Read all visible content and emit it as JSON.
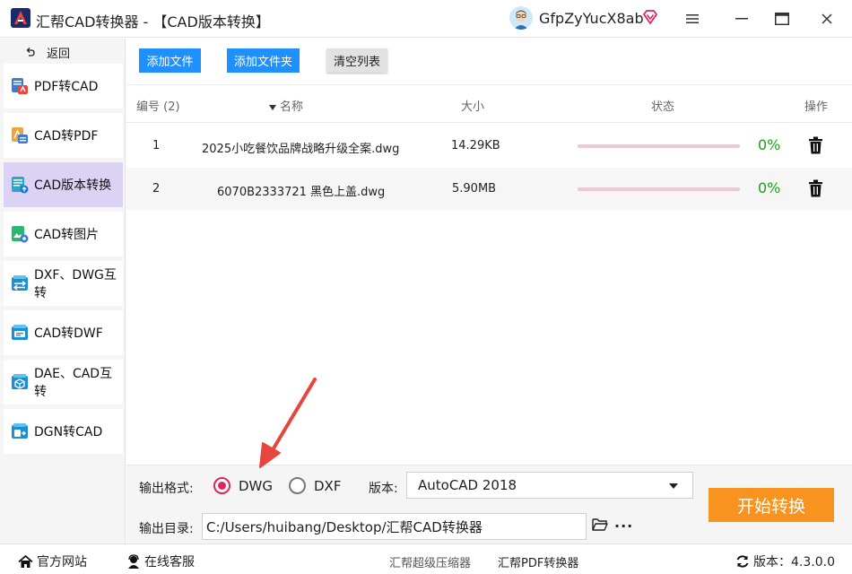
{
  "app": {
    "title": "汇帮CAD转换器 - 【CAD版本转换】",
    "username": "GfpZyYucX8ab"
  },
  "sidebar": {
    "back_label": "返回",
    "items": [
      {
        "label": "PDF转CAD",
        "icon": "pdf-to-cad-icon"
      },
      {
        "label": "CAD转PDF",
        "icon": "cad-to-pdf-icon"
      },
      {
        "label": "CAD版本转换",
        "icon": "cad-version-icon",
        "active": true
      },
      {
        "label": "CAD转图片",
        "icon": "cad-to-image-icon"
      },
      {
        "label": "DXF、DWG互转",
        "icon": "dxf-dwg-icon"
      },
      {
        "label": "CAD转DWF",
        "icon": "cad-to-dwf-icon"
      },
      {
        "label": "DAE、CAD互转",
        "icon": "dae-cad-icon"
      },
      {
        "label": "DGN转CAD",
        "icon": "dgn-to-cad-icon"
      }
    ]
  },
  "toolbar": {
    "add_file": "添加文件",
    "add_folder": "添加文件夹",
    "clear_list": "清空列表"
  },
  "table": {
    "headers": {
      "index": "编号 (2)",
      "name": "名称",
      "size": "大小",
      "status": "状态",
      "action": "操作"
    },
    "rows": [
      {
        "index": "1",
        "name": "2025小吃餐饮品牌战略升级全案.dwg",
        "size": "14.29KB",
        "progress": 0,
        "percent": "0%"
      },
      {
        "index": "2",
        "name": "6070B2333721 黑色上盖.dwg",
        "size": "5.90MB",
        "progress": 0,
        "percent": "0%"
      }
    ]
  },
  "options": {
    "format_label": "输出格式:",
    "format_dwg": "DWG",
    "format_dxf": "DXF",
    "selected_format": "DWG",
    "version_label": "版本:",
    "version_value": "AutoCAD 2018",
    "output_dir_label": "输出目录:",
    "output_dir_value": "C:/Users/huibang/Desktop/汇帮CAD转换器",
    "more": "···",
    "start_button": "开始转换"
  },
  "statusbar": {
    "website": "官方网站",
    "support": "在线客服",
    "compressor": "汇帮超级压缩器",
    "pdf_converter": "汇帮PDF转换器",
    "version": "版本：4.3.0.0"
  },
  "colors": {
    "accent_blue": "#1e90ff",
    "start_orange": "#f7931e",
    "active_sidebar": "#dcd3f4",
    "percent_green": "#1aa01a",
    "annotation_red": "#e8453c",
    "radio_checked": "#e0245e"
  }
}
